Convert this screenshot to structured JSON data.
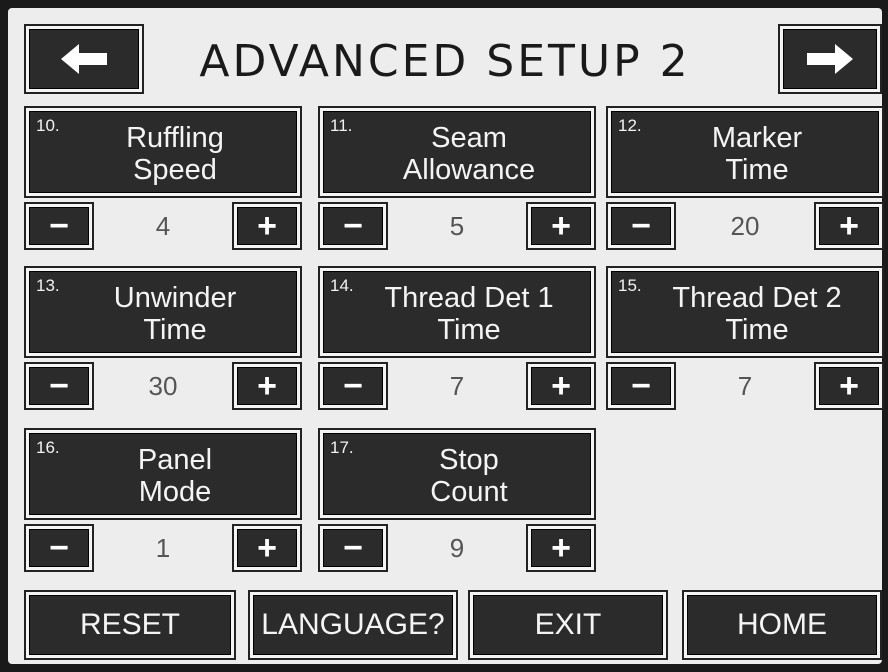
{
  "header": {
    "title": "ADVANCED SETUP 2",
    "prev_icon": "arrow-left",
    "next_icon": "arrow-right"
  },
  "params": [
    {
      "num": "10.",
      "line1": "Ruffling",
      "line2": "Speed",
      "value": "4",
      "minus": "−",
      "plus": "+"
    },
    {
      "num": "11.",
      "line1": "Seam",
      "line2": "Allowance",
      "value": "5",
      "minus": "−",
      "plus": "+"
    },
    {
      "num": "12.",
      "line1": "Marker",
      "line2": "Time",
      "value": "20",
      "minus": "−",
      "plus": "+"
    },
    {
      "num": "13.",
      "line1": "Unwinder",
      "line2": "Time",
      "value": "30",
      "minus": "−",
      "plus": "+"
    },
    {
      "num": "14.",
      "line1": "Thread Det 1",
      "line2": "Time",
      "value": "7",
      "minus": "−",
      "plus": "+"
    },
    {
      "num": "15.",
      "line1": "Thread Det 2",
      "line2": "Time",
      "value": "7",
      "minus": "−",
      "plus": "+"
    },
    {
      "num": "16.",
      "line1": "Panel",
      "line2": "Mode",
      "value": "1",
      "minus": "−",
      "plus": "+"
    },
    {
      "num": "17.",
      "line1": "Stop",
      "line2": "Count",
      "value": "9",
      "minus": "−",
      "plus": "+"
    }
  ],
  "footer": {
    "reset": "RESET",
    "language": "LANGUAGE?",
    "exit": "EXIT",
    "home": "HOME"
  }
}
